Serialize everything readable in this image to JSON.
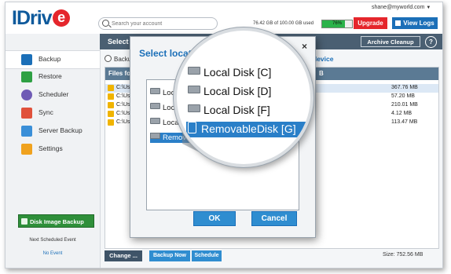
{
  "app": {
    "logo_text": "IDriv",
    "logo_e": "e"
  },
  "header": {
    "search_placeholder": "Search your account",
    "user_email": "shane@myworld.com",
    "quota_text": "76.42 GB of 100.00 GB used",
    "quota_percent_label": "76%",
    "quota_fraction": 0.76,
    "upgrade_label": "Upgrade",
    "view_logs_label": "View Logs"
  },
  "sidebar": {
    "items": [
      {
        "label": "Backup",
        "icon": "backup-arrow-up-icon",
        "color": "#1b6fb8"
      },
      {
        "label": "Restore",
        "icon": "restore-arrow-down-icon",
        "color": "#2ea043"
      },
      {
        "label": "Scheduler",
        "icon": "scheduler-clock-icon",
        "color": "#6f5bb5"
      },
      {
        "label": "Sync",
        "icon": "sync-icon",
        "color": "#e0513b"
      },
      {
        "label": "Server Backup",
        "icon": "server-icon",
        "color": "#3a8fd8"
      },
      {
        "label": "Settings",
        "icon": "gear-icon",
        "color": "#f0a21e"
      }
    ],
    "disk_image_label": "Disk Image Backup",
    "next_scheduled_title": "Next Scheduled Event",
    "next_scheduled_value": "No Event"
  },
  "main": {
    "header_title": "Select",
    "archive_cleanup_label": "Archive Cleanup",
    "help_label": "?",
    "radio_label": "Backu",
    "device_label": "device",
    "files_header_left": "Files fo",
    "files_header_right": "B",
    "rows": [
      {
        "path": "C:\\Use",
        "size": "367.76 MB"
      },
      {
        "path": "C:\\Use",
        "size": "57.20 MB"
      },
      {
        "path": "C:\\Use",
        "size": "210.01 MB"
      },
      {
        "path": "C:\\Use",
        "size": "4.12 MB"
      },
      {
        "path": "C:\\Use",
        "size": "113.47 MB"
      }
    ],
    "change_label": "Change ...",
    "backup_now_label": "Backup Now",
    "schedule_label": "Schedule",
    "size_total": "Size: 752.56 MB"
  },
  "dialog": {
    "title": "Select location",
    "close_label": "×",
    "list_items": [
      "Local",
      "Local",
      "Local",
      "Remova"
    ],
    "ok_label": "OK",
    "cancel_label": "Cancel"
  },
  "magnifier": {
    "items": [
      "Local Disk [C]",
      "Local Disk [D]",
      "Local Disk [F]",
      "RemovableDisk [G]"
    ]
  }
}
